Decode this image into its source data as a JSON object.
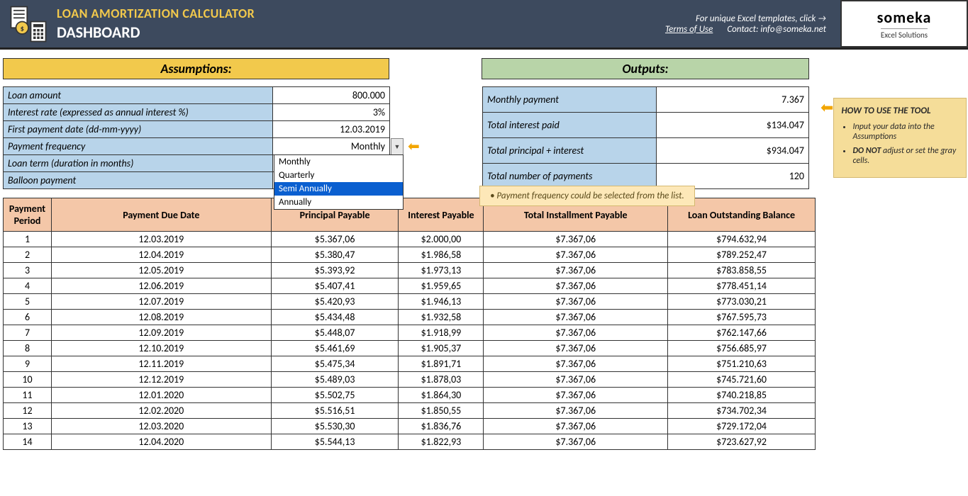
{
  "header": {
    "title": "LOAN AMORTIZATION CALCULATOR",
    "subtitle": "DASHBOARD",
    "terms": "Terms of Use",
    "click_text": "For unique Excel templates, click →",
    "contact": "Contact: info@someka.net",
    "logo_name": "someka",
    "logo_sub": "Excel Solutions"
  },
  "sections": {
    "assumptions": "Assumptions:",
    "outputs": "Outputs:"
  },
  "assumptions": [
    {
      "label": "Loan amount",
      "value": "800.000"
    },
    {
      "label": "Interest rate (expressed as annual interest %)",
      "value": "3%"
    },
    {
      "label": "First payment date (dd-mm-yyyy)",
      "value": "12.03.2019"
    },
    {
      "label": "Payment frequency",
      "value": "Monthly"
    },
    {
      "label": "Loan term (duration in months)",
      "value": ""
    },
    {
      "label": "Balloon payment",
      "value": ""
    }
  ],
  "dropdown": {
    "options": [
      "Monthly",
      "Quarterly",
      "Semi Annually",
      "Annually"
    ],
    "selected": "Semi Annually"
  },
  "outputs": [
    {
      "label": "Monthly payment",
      "value": "7.367"
    },
    {
      "label": "Total interest paid",
      "value": "$134.047"
    },
    {
      "label": "Total principal + interest",
      "value": "$934.047"
    },
    {
      "label": "Total number of payments",
      "value": "120"
    }
  ],
  "hint": "Payment frequency could be selected from the list.",
  "tips": {
    "title": "HOW TO USE THE TOOL",
    "items": [
      "Input your data into the Assumptions",
      "<b>DO NOT</b> adjust or set the gray cells."
    ]
  },
  "schedule": {
    "headers": [
      "Payment Period",
      "Payment Due Date",
      "Principal Payable",
      "Interest Payable",
      "Total Installment Payable",
      "Loan Outstanding Balance"
    ],
    "rows": [
      [
        "1",
        "12.03.2019",
        "$5.367,06",
        "$2.000,00",
        "$7.367,06",
        "$794.632,94"
      ],
      [
        "2",
        "12.04.2019",
        "$5.380,47",
        "$1.986,58",
        "$7.367,06",
        "$789.252,47"
      ],
      [
        "3",
        "12.05.2019",
        "$5.393,92",
        "$1.973,13",
        "$7.367,06",
        "$783.858,55"
      ],
      [
        "4",
        "12.06.2019",
        "$5.407,41",
        "$1.959,65",
        "$7.367,06",
        "$778.451,14"
      ],
      [
        "5",
        "12.07.2019",
        "$5.420,93",
        "$1.946,13",
        "$7.367,06",
        "$773.030,21"
      ],
      [
        "6",
        "12.08.2019",
        "$5.434,48",
        "$1.932,58",
        "$7.367,06",
        "$767.595,73"
      ],
      [
        "7",
        "12.09.2019",
        "$5.448,07",
        "$1.918,99",
        "$7.367,06",
        "$762.147,66"
      ],
      [
        "8",
        "12.10.2019",
        "$5.461,69",
        "$1.905,37",
        "$7.367,06",
        "$756.685,97"
      ],
      [
        "9",
        "12.11.2019",
        "$5.475,34",
        "$1.891,71",
        "$7.367,06",
        "$751.210,63"
      ],
      [
        "10",
        "12.12.2019",
        "$5.489,03",
        "$1.878,03",
        "$7.367,06",
        "$745.721,60"
      ],
      [
        "11",
        "12.01.2020",
        "$5.502,75",
        "$1.864,30",
        "$7.367,06",
        "$740.218,85"
      ],
      [
        "12",
        "12.02.2020",
        "$5.516,51",
        "$1.850,55",
        "$7.367,06",
        "$734.702,34"
      ],
      [
        "13",
        "12.03.2020",
        "$5.530,30",
        "$1.836,76",
        "$7.367,06",
        "$729.172,04"
      ],
      [
        "14",
        "12.04.2020",
        "$5.544,13",
        "$1.822,93",
        "$7.367,06",
        "$723.627,92"
      ]
    ]
  }
}
